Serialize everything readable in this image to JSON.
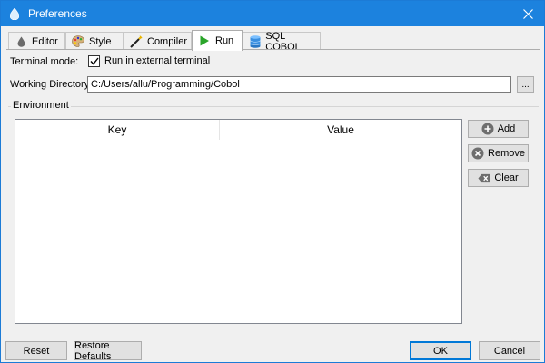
{
  "window": {
    "title": "Preferences"
  },
  "tabs": [
    {
      "label": "Editor",
      "icon": "drop-icon"
    },
    {
      "label": "Style",
      "icon": "palette-icon"
    },
    {
      "label": "Compiler",
      "icon": "wand-icon"
    },
    {
      "label": "Run",
      "icon": "play-icon",
      "active": true
    },
    {
      "label": "SQL COBOL",
      "icon": "database-icon"
    }
  ],
  "run": {
    "terminal_mode_label": "Terminal mode:",
    "external_terminal_label": "Run in external terminal",
    "external_terminal_checked": true,
    "working_dir_label": "Working Directory:",
    "working_dir_value": "C:/Users/allu/Programming/Cobol",
    "browse_label": "...",
    "environment_label": "Environment",
    "table": {
      "columns": [
        "Key",
        "Value"
      ],
      "rows": []
    },
    "add_label": "Add",
    "remove_label": "Remove",
    "clear_label": "Clear"
  },
  "footer": {
    "reset_label": "Reset",
    "restore_label": "Restore Defaults",
    "ok_label": "OK",
    "cancel_label": "Cancel"
  },
  "colors": {
    "titlebar": "#1c82de",
    "accent": "#0078d7"
  }
}
